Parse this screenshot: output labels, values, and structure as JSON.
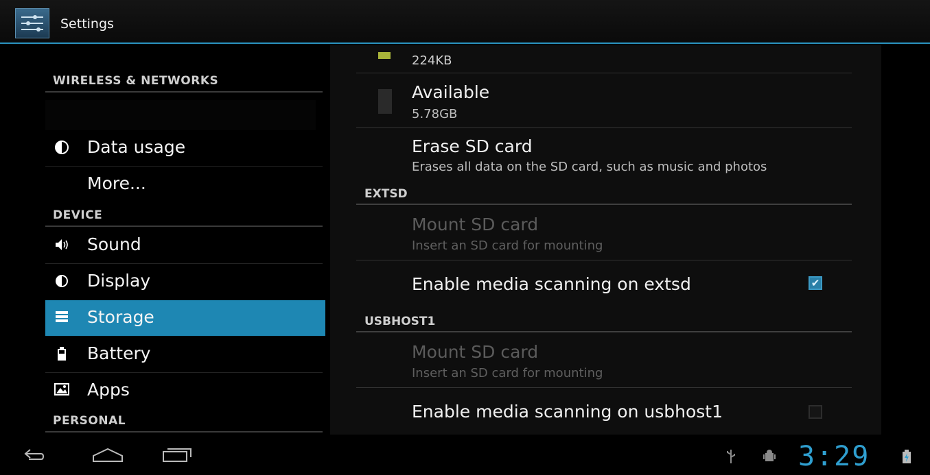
{
  "actionbar": {
    "title": "Settings",
    "icon": "settings-sliders-icon"
  },
  "nav": {
    "categories": {
      "wireless": "WIRELESS & NETWORKS",
      "device": "DEVICE",
      "personal": "PERSONAL"
    },
    "items": [
      {
        "label": "Data usage",
        "icon": "data-usage-icon"
      },
      {
        "label": "More...",
        "icon": ""
      },
      {
        "label": "Sound",
        "icon": "speaker-icon"
      },
      {
        "label": "Display",
        "icon": "display-brightness-icon"
      },
      {
        "label": "Storage",
        "icon": "storage-icon",
        "selected": true
      },
      {
        "label": "Battery",
        "icon": "battery-icon"
      },
      {
        "label": "Apps",
        "icon": "apps-icon"
      }
    ]
  },
  "content": {
    "misc_size": "224KB",
    "available": {
      "title": "Available",
      "value": "5.78GB"
    },
    "erase": {
      "title": "Erase SD card",
      "subtitle": "Erases all data on the SD card, such as music and photos"
    },
    "extsd": {
      "header": "EXTSD",
      "mount_title": "Mount SD card",
      "mount_subtitle": "Insert an SD card for mounting",
      "scan_label": "Enable media scanning on extsd",
      "scan_checked": true
    },
    "usbhost1": {
      "header": "USBHOST1",
      "mount_title": "Mount SD card",
      "mount_subtitle": "Insert an SD card for mounting",
      "scan_label": "Enable media scanning on usbhost1",
      "scan_checked": false
    }
  },
  "statusbar": {
    "clock": "3:29",
    "accent_color": "#2f9fd0"
  }
}
